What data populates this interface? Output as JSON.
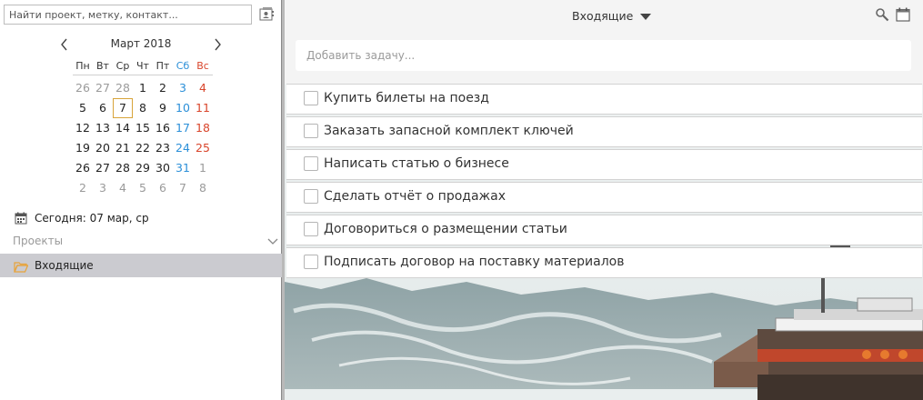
{
  "sidebar": {
    "search": {
      "placeholder": "Найти проект, метку, контакт..."
    },
    "calendar": {
      "month_label": "Март 2018",
      "weekdays": [
        "Пн",
        "Вт",
        "Ср",
        "Чт",
        "Пт",
        "Сб",
        "Вс"
      ],
      "weeks": [
        [
          "26",
          "27",
          "28",
          "1",
          "2",
          "3",
          "4"
        ],
        [
          "5",
          "6",
          "7",
          "8",
          "9",
          "10",
          "11"
        ],
        [
          "12",
          "13",
          "14",
          "15",
          "16",
          "17",
          "18"
        ],
        [
          "19",
          "20",
          "21",
          "22",
          "23",
          "24",
          "25"
        ],
        [
          "26",
          "27",
          "28",
          "29",
          "30",
          "31",
          "1"
        ],
        [
          "2",
          "3",
          "4",
          "5",
          "6",
          "7",
          "8"
        ]
      ],
      "today_label": "Сегодня: 07 мар, ср"
    },
    "projects_label": "Проекты",
    "projects": [
      {
        "label": "Входящие",
        "selected": true
      }
    ]
  },
  "main": {
    "view_title": "Входящие",
    "add_task_placeholder": "Добавить задачу...",
    "tasks": [
      {
        "title": "Купить билеты на поезд",
        "done": false
      },
      {
        "title": "Заказать запасной комплект ключей",
        "done": false
      },
      {
        "title": "Написать статью о бизнесе",
        "done": false
      },
      {
        "title": "Сделать отчёт о продажах",
        "done": false
      },
      {
        "title": "Договориться о размещении статьи",
        "done": false
      },
      {
        "title": "Подписать договор на поставку материалов",
        "done": false
      }
    ]
  },
  "icons": {
    "contacts": "contacts-book-icon",
    "prev_month": "chevron-left-icon",
    "next_month": "chevron-right-icon",
    "today": "calendar-icon",
    "projects_toggle": "chevron-down-icon",
    "project": "folder-open-icon",
    "view_caret": "caret-down-icon",
    "search": "search-icon",
    "calendar_view": "calendar-icon"
  },
  "colors": {
    "weekend_saturday": "#2b8fd8",
    "weekend_sunday": "#d9452b",
    "today_outline": "#d8a43a",
    "selected_project_bg": "#cbcbd0",
    "folder": "#e8a33a"
  }
}
